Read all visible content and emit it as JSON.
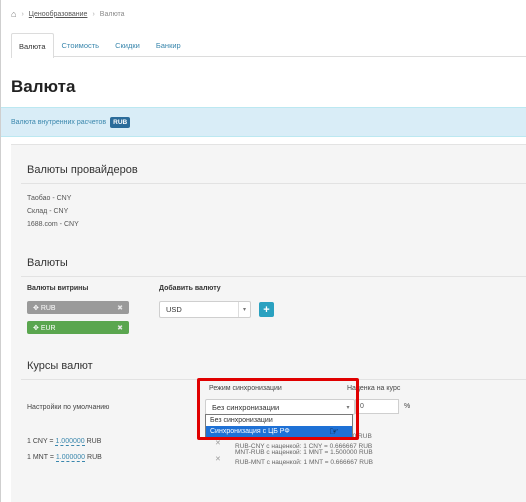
{
  "breadcrumb": {
    "home_icon": "home-icon",
    "items": [
      "Ценообразование",
      "Валюта"
    ]
  },
  "tabs": [
    {
      "label": "Валюта",
      "active": true
    },
    {
      "label": "Стоимость",
      "active": false
    },
    {
      "label": "Скидки",
      "active": false
    },
    {
      "label": "Банкир",
      "active": false
    }
  ],
  "page_title": "Валюта",
  "info": {
    "text": "Валюта внутренних расчетов",
    "badge": "RUB"
  },
  "providers": {
    "title": "Валюты провайдеров",
    "lines": [
      "Таобао - CNY",
      "Склад - CNY",
      "1688.com - CNY"
    ]
  },
  "currencies": {
    "title": "Валюты",
    "storefront_label": "Валюты витрины",
    "storefront": [
      {
        "code": "RUB",
        "color": "#9a9a9a"
      },
      {
        "code": "EUR",
        "color": "#5aa64f"
      }
    ],
    "add_label": "Добавить валюту",
    "add_select_value": "USD",
    "add_button": "+"
  },
  "rates": {
    "title": "Курсы валют",
    "sync_mode_label": "Режим синхронизации",
    "markup_label": "Наценка на курс",
    "default_label": "Настройки по умолчанию",
    "sync_select_value": "Без синхронизации",
    "markup_value": "0",
    "markup_unit": "%",
    "dropdown_options": [
      {
        "label": "Без синхронизации",
        "selected": false
      },
      {
        "label": "Синхронизация с ЦБ РФ",
        "selected": true
      }
    ],
    "rows": [
      {
        "prefix": "1 CNY = ",
        "value": "1.000000",
        "suffix": " RUB",
        "line1": "CNY-RUB с наценкой: 1 CNY = 1.500000 RUB",
        "line2": "RUB-CNY с наценкой: 1 CNY = 0.666667 RUB"
      },
      {
        "prefix": "1 MNT = ",
        "value": "1.000000",
        "suffix": " RUB",
        "line1": "MNT-RUB с наценкой: 1 MNT = 1.500000 RUB",
        "line2": "RUB-MNT с наценкой: 1 MNT = 0.666667 RUB"
      }
    ]
  }
}
